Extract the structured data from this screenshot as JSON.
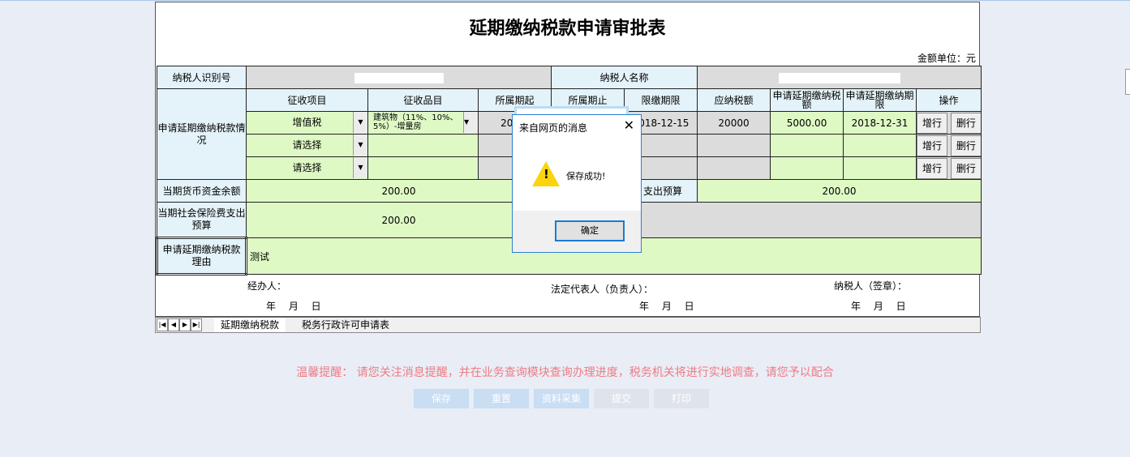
{
  "form": {
    "title": "延期缴纳税款申请审批表",
    "unit": "金额单位：元",
    "taxpayer_id_label": "纳税人识别号",
    "taxpayer_name_label": "纳税人名称",
    "section_label": "申请延期缴纳税款情况",
    "headers": [
      "征收项目",
      "征收品目",
      "所属期起",
      "所属期止",
      "限缴期限",
      "应纳税额",
      "申请延期缴纳税额",
      "申请延期缴纳期限",
      "操作"
    ],
    "rows": [
      {
        "item": "增值税",
        "category": "建筑物（11%、10%、5%）-增量房",
        "period_start": "2018-",
        "deadline": "2018-12-15",
        "tax_due": "20000",
        "defer_amount": "5000.00",
        "defer_deadline": "2018-12-31"
      },
      {
        "item": "请选择"
      },
      {
        "item": "请选择"
      }
    ],
    "add_row": "增行",
    "del_row": "删行",
    "cash_balance_label": "当期货币资金余额",
    "cash_balance": "200.00",
    "expense_label": "支出预算",
    "expense": "200.00",
    "social_label": "当期社会保险费支出预算",
    "social": "200.00",
    "reason_label": "申请延期缴纳税款理由",
    "reason": "测试",
    "handler": "经办人：",
    "legal_rep": "法定代表人（负责人）：",
    "taxpayer_seal": "纳税人（签章）：",
    "date": "年　 月　 日"
  },
  "sheet_tabs": [
    "延期缴纳税款",
    "税务行政许可申请表"
  ],
  "tip": "温馨提醒：  请您关注消息提醒，并在业务查询模块查询办理进度，税务机关将进行实地调查，请您予以配合",
  "buttons": [
    "保存",
    "重置",
    "资料采集",
    "提交",
    "打印"
  ],
  "dialog": {
    "title": "来自网页的消息",
    "message": "保存成功!",
    "ok": "确定",
    "icon": "warning-icon"
  }
}
